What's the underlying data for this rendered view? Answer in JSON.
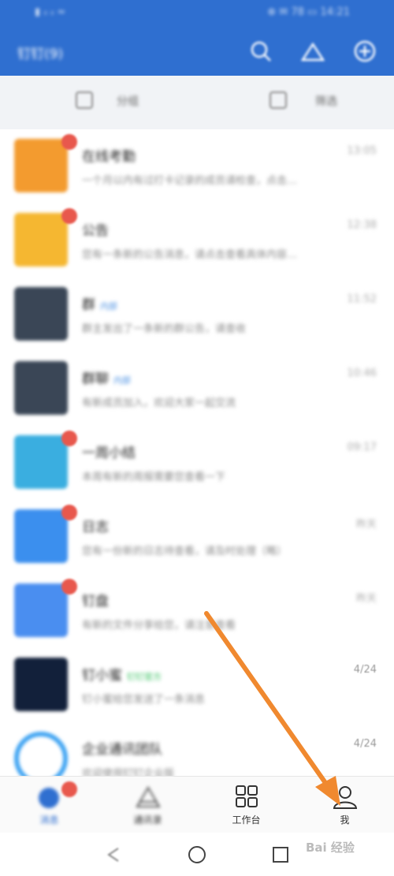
{
  "status_bar": {
    "left": "▮ ᵢₗ ᵢₗ ≈",
    "right": "⊕ ✉ 78 ▭ 14:21"
  },
  "app_bar": {
    "title": "钉钉(9)",
    "icons": [
      "search-icon",
      "add-contact-icon",
      "add-icon"
    ]
  },
  "sub_bar": {
    "left_label": "分组",
    "right_label": "筛选"
  },
  "messages": [
    {
      "title": "在线考勤",
      "subtitle": "一个月以内有过打卡记录的成员请检查，点击…",
      "time": "13:05",
      "avatar_color": "#f39b2f",
      "badge": true
    },
    {
      "title": "公告",
      "subtitle": "您有一条新的公告消息，请点击查看具体内容…",
      "time": "12:38",
      "avatar_color": "#f5b731",
      "badge": true
    },
    {
      "title": "群",
      "tag": "内部",
      "subtitle": "群主发出了一条新的群公告，请查收",
      "time": "11:52",
      "avatar_color": "#3a4656",
      "badge": false
    },
    {
      "title": "群聊",
      "tag": "内部",
      "subtitle": "有新成员加入，欢迎大家一起交流",
      "time": "10:46",
      "avatar_color": "#3a4656",
      "badge": false
    },
    {
      "title": "一周小结",
      "subtitle": "本周有新的周报需要您查看一下",
      "time": "09:17",
      "avatar_color": "#3aaee0",
      "badge": true
    },
    {
      "title": "日志",
      "subtitle": "您有一份新的日志待查看，请及时处理（略）",
      "time": "昨天",
      "avatar_color": "#3b8fee",
      "badge": true
    },
    {
      "title": "钉盘",
      "subtitle": "有新的文件分享给您，请注意查看",
      "time": "昨天",
      "avatar_color": "#4a8ef0",
      "badge": true
    },
    {
      "title": "钉小蜜",
      "tag": "钉钉官方",
      "subtitle": "钉小蜜给您发送了一条消息",
      "time": "4/24",
      "avatar_color": "#12203a",
      "badge": false
    },
    {
      "title": "企业通讯团队",
      "subtitle": "欢迎使用钉钉企业版",
      "time": "4/24",
      "avatar_color": "#3ea3f2",
      "badge": false
    }
  ],
  "tabs": [
    {
      "label": "消息",
      "icon": "message-icon",
      "active": true,
      "badge": true
    },
    {
      "label": "通讯录",
      "icon": "contacts-icon",
      "active": false
    },
    {
      "label": "工作台",
      "icon": "workbench-icon",
      "active": false
    },
    {
      "label": "我",
      "icon": "person-icon",
      "active": false
    }
  ],
  "nav_bar": {
    "icons": [
      "back-icon",
      "home-icon",
      "recents-icon"
    ]
  },
  "watermark": "Bai 经验",
  "colors": {
    "brand_blue": "#2f6fd0",
    "badge_red": "#e8584d",
    "arrow_orange": "#f0892f"
  }
}
